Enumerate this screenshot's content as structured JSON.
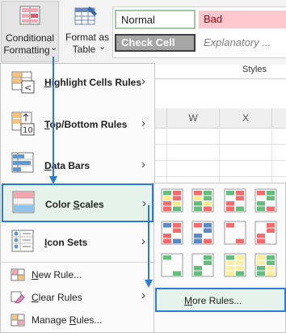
{
  "ribbon": {
    "conditional_formatting": {
      "line1": "Conditional",
      "line2": "Formatting",
      "dropdown": "⌄"
    },
    "format_as_table": {
      "line1": "Format as",
      "line2": "Table",
      "dropdown": "⌄"
    },
    "styles": {
      "normal": "Normal",
      "bad": "Bad",
      "check_cell": "Check Cell",
      "explanatory": "Explanatory ...",
      "group_label": "Styles"
    },
    "colors": {
      "bad_bg": "#ffc7ce",
      "bad_fg": "#9c0006",
      "check_bg": "#a5a5a5",
      "normal_border": "#9ec8a8"
    }
  },
  "sheet": {
    "columns": [
      "W",
      "X"
    ]
  },
  "menu": {
    "items": [
      {
        "label_pre": "",
        "label_key": "H",
        "label_post": "ighlight Cells Rules",
        "icon": "highlight-cells-icon"
      },
      {
        "label_pre": "",
        "label_key": "T",
        "label_post": "op/Bottom Rules",
        "icon": "top-bottom-icon"
      },
      {
        "label_pre": "",
        "label_key": "D",
        "label_post": "ata Bars",
        "icon": "data-bars-icon"
      },
      {
        "label_pre": "Color ",
        "label_key": "S",
        "label_post": "cales",
        "icon": "color-scales-icon"
      },
      {
        "label_pre": "",
        "label_key": "I",
        "label_post": "con Sets",
        "icon": "icon-sets-icon"
      }
    ],
    "small_items": [
      {
        "label_pre": "",
        "label_key": "N",
        "label_post": "ew Rule..."
      },
      {
        "label_pre": "",
        "label_key": "C",
        "label_post": "lear Rules"
      },
      {
        "label_pre": "Manage ",
        "label_key": "R",
        "label_post": "ules..."
      }
    ],
    "chevron": "›",
    "highlight_color": "#e6f3ec",
    "accent": "#2b7bd6"
  },
  "submenu": {
    "more_rules_pre": "",
    "more_rules_key": "M",
    "more_rules_post": "ore Rules..."
  }
}
